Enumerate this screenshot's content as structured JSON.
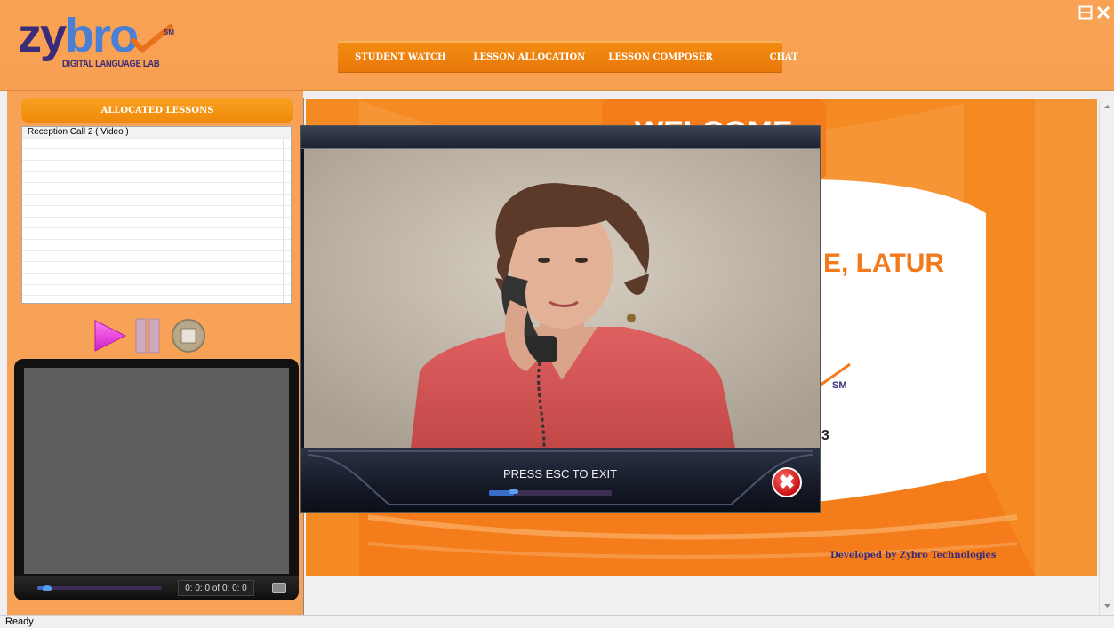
{
  "app": {
    "logo_word_left": "zy",
    "logo_word_o1": "b",
    "logo_word_mid": "r",
    "logo_word_o2": "o",
    "logo_sm": "SM",
    "logo_subtitle": "DIGITAL LANGUAGE LAB"
  },
  "nav": {
    "items": [
      {
        "label": "STUDENT WATCH"
      },
      {
        "label": "LESSON ALLOCATION"
      },
      {
        "label": "LESSON COMPOSER"
      },
      {
        "label": "CHAT"
      }
    ]
  },
  "left_panel": {
    "header": "ALLOCATED LESSONS",
    "lessons": [
      "Reception Call 2 ( Video )"
    ],
    "player_time": "0: 0: 0 of  0: 0: 0",
    "player_progress": 0.08
  },
  "welcome": {
    "heading_partial": "WELCOME",
    "place_partial": "E, LATUR",
    "sm_text": "SM",
    "partial_digit": "3",
    "developer": "Developed by Zybro Technologies"
  },
  "video_overlay": {
    "instruction": "PRESS ESC TO EXIT",
    "progress": 0.2,
    "close_glyph": "✖"
  },
  "status_bar": {
    "text": "Ready"
  },
  "colors": {
    "header_bg": "#f9a255",
    "nav_bg": "#f08a0a",
    "brand_purple": "#3b2c7a",
    "welcome_orange": "#f37a1c"
  }
}
